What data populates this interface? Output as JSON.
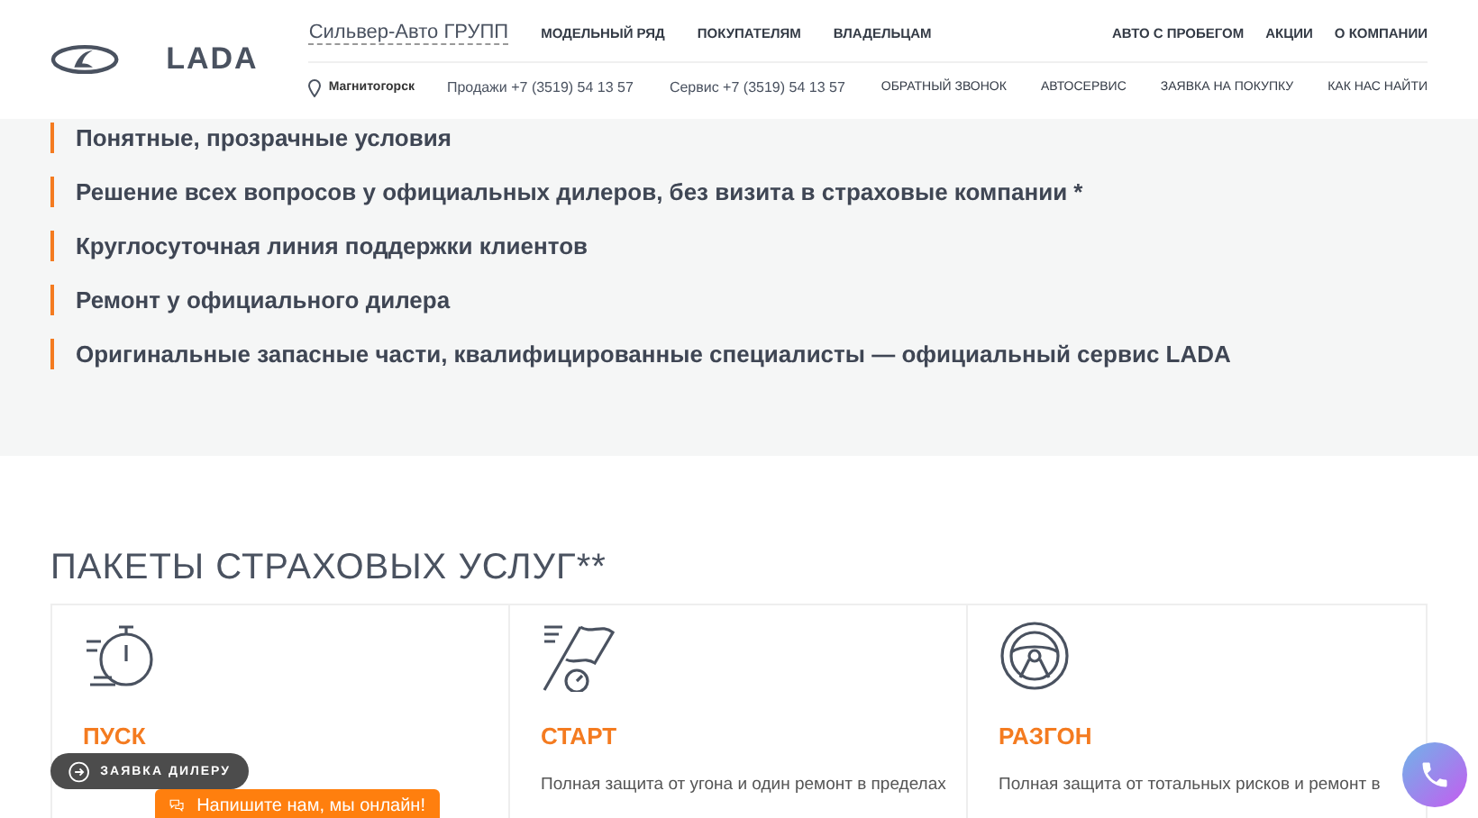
{
  "header": {
    "brand": "LADA",
    "dealer": "Сильвер-Авто ГРУПП",
    "main_nav": [
      "МОДЕЛЬНЫЙ РЯД",
      "ПОКУПАТЕЛЯМ",
      "ВЛАДЕЛЬЦАМ"
    ],
    "right_nav": [
      "АВТО С ПРОБЕГОМ",
      "АКЦИИ",
      "О КОМПАНИИ"
    ],
    "city": "Магнитогорск",
    "phones": [
      "Продажи +7 (3519) 54 13 57",
      "Сервис +7 (3519) 54 13 57"
    ],
    "sub_nav": [
      "ОБРАТНЫЙ ЗВОНОК",
      "АВТОСЕРВИС",
      "ЗАЯВКА НА ПОКУПКУ",
      "КАК НАС НАЙТИ"
    ]
  },
  "benefits": [
    "Понятные, прозрачные условия",
    "Решение всех вопросов у официальных дилеров, без визита в страховые компании *",
    "Круглосуточная линия поддержки клиентов",
    "Ремонт у официального дилера",
    "Оригинальные запасные части, квалифицированные специалисты — официальный сервис LADA"
  ],
  "packages": {
    "title": "ПАКЕТЫ СТРАХОВЫХ УСЛУГ**",
    "cards": [
      {
        "kind": "stopwatch",
        "name": "ПУСК"
      },
      {
        "kind": "flag",
        "name": "СТАРТ",
        "description": "Полная защита от угона и один ремонт в пределах"
      },
      {
        "kind": "wheel",
        "name": "РАЗГОН",
        "description": "Полная защита от тотальных рисков и ремонт в"
      }
    ]
  },
  "floating": {
    "dealer_button": "ЗАЯВКА ДИЛЕРУ",
    "chat_button": "Напишите нам, мы онлайн!"
  }
}
